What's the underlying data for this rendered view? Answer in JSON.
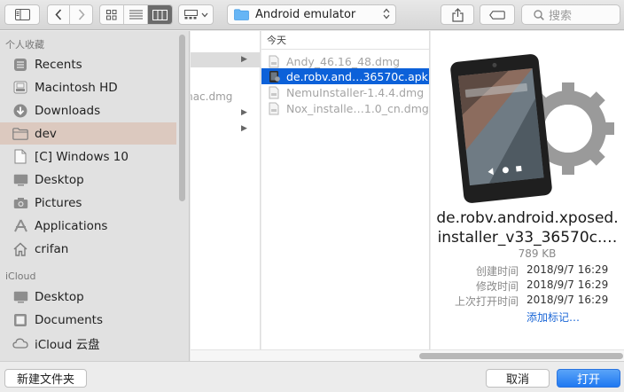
{
  "toolbar": {
    "path_label": "Android emulator",
    "search_placeholder": "搜索",
    "icons": [
      "sidebar-toggle-icon",
      "chevron-left-icon",
      "chevron-right-icon",
      "icon-view-icon",
      "list-view-icon",
      "column-view-icon",
      "gallery-view-icon",
      "share-icon",
      "tag-icon",
      "search-icon"
    ]
  },
  "sidebar": {
    "favorites_header": "个人收藏",
    "favorites": [
      {
        "label": "Recents",
        "icon": "clock-icon"
      },
      {
        "label": "Macintosh HD",
        "icon": "hard-drive-icon"
      },
      {
        "label": "Downloads",
        "icon": "download-icon"
      },
      {
        "label": "dev",
        "icon": "folder-icon",
        "selected": true
      },
      {
        "label": "[C] Windows 10",
        "icon": "document-icon"
      },
      {
        "label": "Desktop",
        "icon": "desktop-icon"
      },
      {
        "label": "Pictures",
        "icon": "camera-icon"
      },
      {
        "label": "Applications",
        "icon": "applications-icon"
      },
      {
        "label": "crifan",
        "icon": "home-icon"
      }
    ],
    "icloud_header": "iCloud",
    "icloud": [
      {
        "label": "Desktop",
        "icon": "desktop-icon"
      },
      {
        "label": "Documents",
        "icon": "documents-icon"
      },
      {
        "label": "iCloud 云盘",
        "icon": "cloud-icon"
      }
    ]
  },
  "column1": {
    "truncated_item": "mac.dmg"
  },
  "column2": {
    "group_header": "今天",
    "files": [
      {
        "name": "Andy_46.16_48.dmg",
        "selected": false
      },
      {
        "name": "de.robv.and…36570c.apk",
        "selected": true
      },
      {
        "name": "NemuInstaller-1.4.4.dmg",
        "selected": false
      },
      {
        "name": "Nox_installe…1.0_cn.dmg",
        "selected": false
      }
    ]
  },
  "preview": {
    "name_line1": "de.robv.android.xposed.",
    "name_line2": "installer_v33_36570c.…",
    "size": "789 KB",
    "meta": [
      {
        "key": "创建时间",
        "value": "2018/9/7 16:29"
      },
      {
        "key": "修改时间",
        "value": "2018/9/7 16:29"
      },
      {
        "key": "上次打开时间",
        "value": "2018/9/7 16:29"
      }
    ],
    "add_tags": "添加标记…"
  },
  "bottom": {
    "new_folder": "新建文件夹",
    "cancel": "取消",
    "open": "打开"
  },
  "colors": {
    "selection_blue": "#0c61d9",
    "sidebar_selected": "#dcc9bf",
    "primary_button": "#1f78f1"
  }
}
